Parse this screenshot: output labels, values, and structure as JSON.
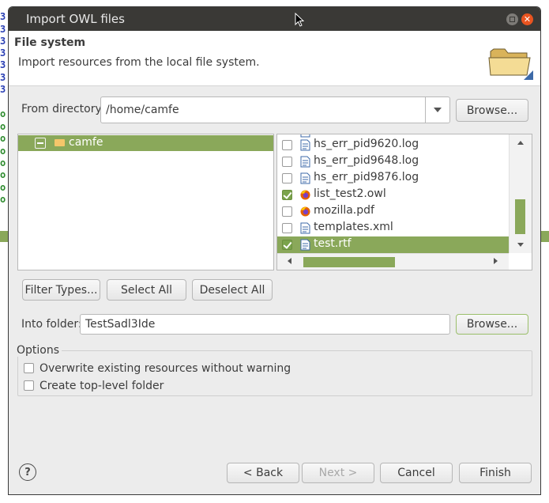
{
  "background": {
    "numbers": [
      "3",
      "3",
      "3",
      "3",
      "3",
      "3",
      "3"
    ],
    "markers": [
      "o",
      "o",
      "o",
      "o",
      "o",
      "o",
      "o",
      "o"
    ]
  },
  "window": {
    "title": "Import OWL files"
  },
  "header": {
    "title": "File system",
    "description": "Import resources from the local file system."
  },
  "from_directory": {
    "label": "From directory:",
    "value": "/home/camfe",
    "browse_label": "Browse..."
  },
  "tree": {
    "items": [
      {
        "label": "camfe",
        "state": "partial",
        "selected": true
      }
    ]
  },
  "files": [
    {
      "name": "hs_err_pid9620.log",
      "checked": false,
      "icon": "text-file-icon"
    },
    {
      "name": "hs_err_pid9648.log",
      "checked": false,
      "icon": "text-file-icon"
    },
    {
      "name": "hs_err_pid9876.log",
      "checked": false,
      "icon": "text-file-icon"
    },
    {
      "name": "list_test2.owl",
      "checked": true,
      "icon": "firefox-icon"
    },
    {
      "name": "mozilla.pdf",
      "checked": false,
      "icon": "firefox-icon"
    },
    {
      "name": "templates.xml",
      "checked": false,
      "icon": "text-file-icon"
    },
    {
      "name": "test.rtf",
      "checked": true,
      "icon": "text-file-icon",
      "selected": true
    }
  ],
  "selection_buttons": {
    "filter_types": "Filter Types...",
    "select_all": "Select All",
    "deselect_all": "Deselect All"
  },
  "into_folder": {
    "label": "Into folder:",
    "value": "TestSadl3Ide",
    "browse_label": "Browse..."
  },
  "options": {
    "title": "Options",
    "overwrite": {
      "label": "Overwrite existing resources without warning",
      "checked": false
    },
    "top_level": {
      "label": "Create top-level folder",
      "checked": false
    }
  },
  "footer": {
    "help_symbol": "?",
    "back": "< Back",
    "next": "Next >",
    "cancel": "Cancel",
    "finish": "Finish"
  },
  "colors": {
    "accent": "#8aa85a",
    "titlebar": "#3a3936",
    "close": "#e95420"
  }
}
